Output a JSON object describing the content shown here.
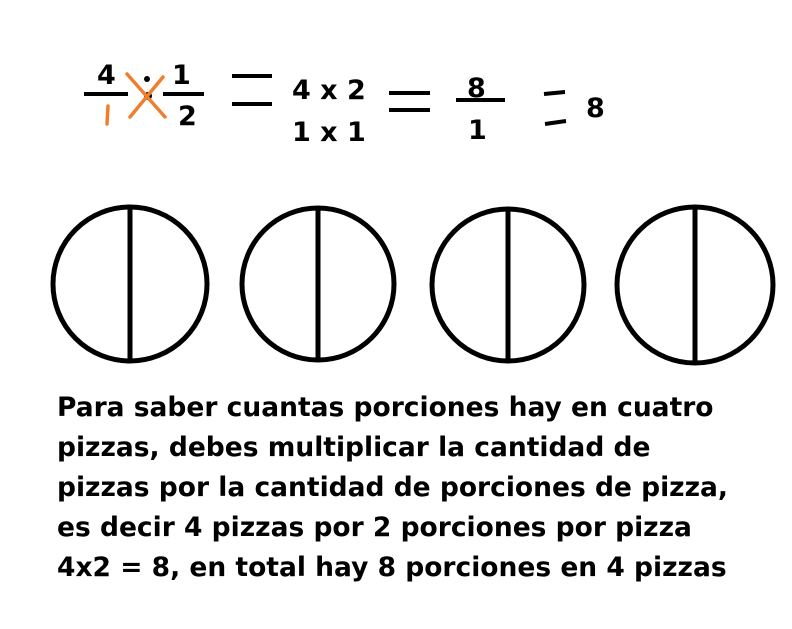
{
  "equation": {
    "frac1": {
      "num": "4",
      "den": "1"
    },
    "division_symbol": "÷",
    "frac2": {
      "num": "1",
      "den": "2"
    },
    "step1": {
      "top": "4 x 2",
      "bottom": "1 x 1"
    },
    "frac3": {
      "num": "8",
      "den": "1"
    },
    "result": "8"
  },
  "pizzas": [
    {
      "slices": 2
    },
    {
      "slices": 2
    },
    {
      "slices": 2
    },
    {
      "slices": 2
    }
  ],
  "explanation": {
    "lines": [
      "Para saber cuantas porciones hay en cuatro",
      "pizzas, debes multiplicar la cantidad de",
      "pizzas por la cantidad de porciones de pizza,",
      "es decir 4 pizzas por 2 porciones por pizza",
      "4x2 = 8, en total hay 8 porciones en 4 pizzas"
    ]
  },
  "colors": {
    "ink": "#000000",
    "cross_multiply": "#f07f2d",
    "background": "#ffffff"
  }
}
